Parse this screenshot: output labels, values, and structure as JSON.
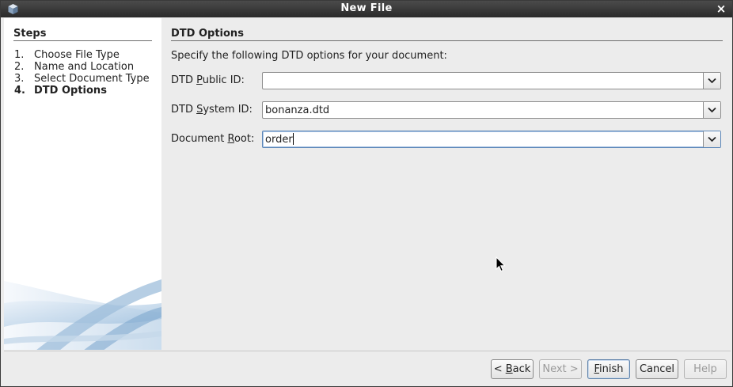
{
  "window": {
    "title": "New File",
    "close_glyph": "×"
  },
  "steps": {
    "title": "Steps",
    "items": [
      {
        "num": "1.",
        "label": "Choose File Type",
        "current": false
      },
      {
        "num": "2.",
        "label": "Name and Location",
        "current": false
      },
      {
        "num": "3.",
        "label": "Select Document Type",
        "current": false
      },
      {
        "num": "4.",
        "label": "DTD Options",
        "current": true
      }
    ]
  },
  "main": {
    "section_title": "DTD Options",
    "description": "Specify the following DTD options for your document:",
    "fields": {
      "public_id": {
        "label_pre": "DTD ",
        "label_mnemonic": "P",
        "label_post": "ublic ID:",
        "value": ""
      },
      "system_id": {
        "label_pre": "DTD ",
        "label_mnemonic": "S",
        "label_post": "ystem ID:",
        "value": "bonanza.dtd"
      },
      "document_root": {
        "label_pre": "Document ",
        "label_mnemonic": "R",
        "label_post": "oot:",
        "value": "order"
      }
    }
  },
  "buttons": {
    "back": {
      "pre": "< ",
      "mnemonic": "B",
      "post": "ack"
    },
    "next": {
      "label": "Next >"
    },
    "finish": {
      "pre": "",
      "mnemonic": "F",
      "post": "inish"
    },
    "cancel": {
      "label": "Cancel"
    },
    "help": {
      "label": "Help"
    }
  },
  "colors": {
    "titlebar": "#2f2f2f",
    "dialog_bg": "#ececec",
    "focus_border": "#5b86b8"
  }
}
